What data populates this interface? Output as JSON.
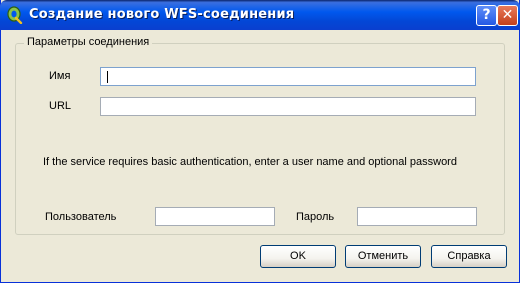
{
  "window": {
    "title": "Создание нового WFS-соединения",
    "help_glyph": "?",
    "close_glyph": "✕",
    "icon": "qgis-icon"
  },
  "group": {
    "title": "Параметры соединения",
    "name_label": "Имя",
    "name_value": "",
    "url_label": "URL",
    "url_value": "",
    "auth_note": "If the service requires basic authentication, enter a user name and optional password",
    "user_label": "Пользователь",
    "user_value": "",
    "password_label": "Пароль",
    "password_value": ""
  },
  "buttons": {
    "ok": "OK",
    "cancel": "Отменить",
    "help": "Справка"
  }
}
